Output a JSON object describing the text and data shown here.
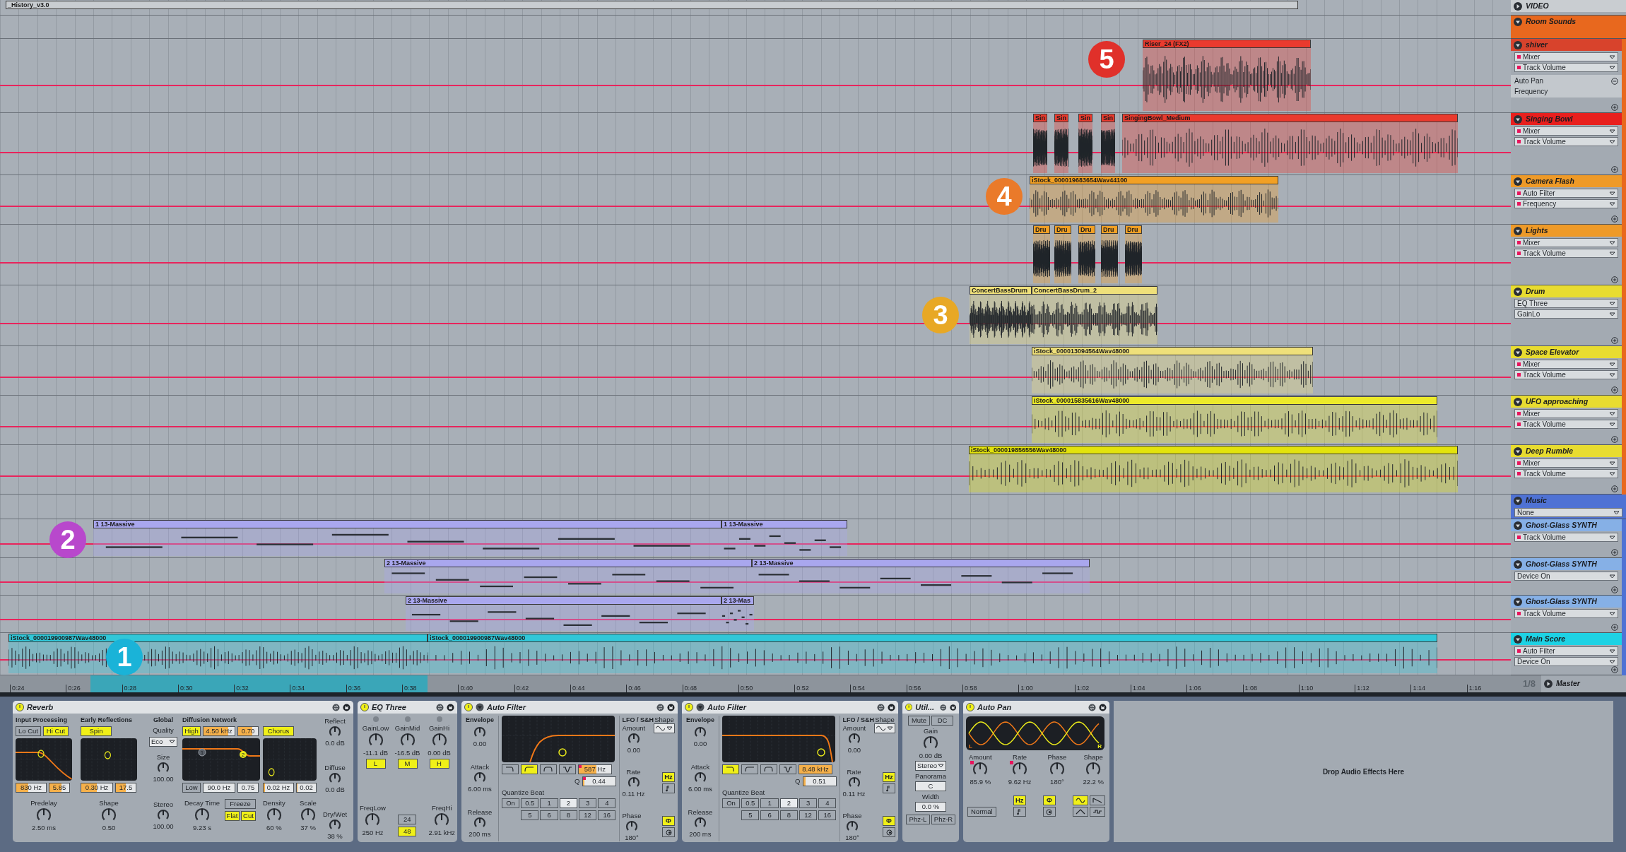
{
  "tracks": [
    {
      "kind": "video",
      "name": "VIDEO",
      "color": "#c9cdd1",
      "expanded": false,
      "clips": [
        {
          "label": "_History_v3.0",
          "color": "#c9cdd1"
        }
      ]
    },
    {
      "kind": "group",
      "name": "Room Sounds",
      "color": "#e8681e",
      "expanded": true,
      "children": [
        {
          "kind": "audio",
          "name": "shiver",
          "color": "#d8432c",
          "expanded": true,
          "choosers": [
            {
              "label": "Mixer",
              "automated": true
            },
            {
              "label": "Track Volume",
              "automated": true
            }
          ],
          "sub": {
            "device": "Auto Pan",
            "parameter": "Frequency"
          },
          "clips": [
            {
              "label": "Riser_24 (FX2)",
              "color": "#ea3a2e"
            }
          ]
        },
        {
          "kind": "audio",
          "name": "Singing Bowl",
          "color": "#e8201e",
          "expanded": true,
          "choosers": [
            {
              "label": "Mixer",
              "automated": true
            },
            {
              "label": "Track Volume",
              "automated": true
            }
          ],
          "clips": [
            {
              "label": "Sin",
              "color": "#ea3a2e"
            },
            {
              "label": "Sin",
              "color": "#ea3a2e"
            },
            {
              "label": "Sin",
              "color": "#ea3a2e"
            },
            {
              "label": "Sin",
              "color": "#ea3a2e"
            },
            {
              "label": "SingingBowl_Medium",
              "color": "#ea3a2e"
            }
          ]
        },
        {
          "kind": "audio",
          "name": "Camera Flash",
          "color": "#ee9a28",
          "expanded": true,
          "choosers": [
            {
              "label": "Auto Filter",
              "automated": true
            },
            {
              "label": "Frequency",
              "automated": true
            }
          ],
          "clips": [
            {
              "label": "iStock_000019683654Wav44100",
              "color": "#f2a024"
            }
          ]
        },
        {
          "kind": "audio",
          "name": "Lights",
          "color": "#ee9a28",
          "expanded": true,
          "choosers": [
            {
              "label": "Mixer",
              "automated": true
            },
            {
              "label": "Track Volume",
              "automated": true
            }
          ],
          "clips": [
            {
              "label": "Dru",
              "color": "#f2a024"
            },
            {
              "label": "Dru",
              "color": "#f2a024"
            },
            {
              "label": "Dru",
              "color": "#f2a024"
            },
            {
              "label": "Dru",
              "color": "#f2a024"
            },
            {
              "label": "Dru",
              "color": "#f2a024"
            }
          ]
        },
        {
          "kind": "audio",
          "name": "Drum",
          "color": "#e8dc30",
          "expanded": true,
          "choosers": [
            {
              "label": "EQ Three",
              "automated": false
            },
            {
              "label": "GainLo",
              "automated": false
            }
          ],
          "clips": [
            {
              "label": "ConcertBassDrum",
              "color": "#efe07a"
            },
            {
              "label": "ConcertBassDrum_2",
              "color": "#efe07a"
            }
          ]
        },
        {
          "kind": "audio",
          "name": "Space Elevator",
          "color": "#e8dc30",
          "expanded": true,
          "choosers": [
            {
              "label": "Mixer",
              "automated": true
            },
            {
              "label": "Track Volume",
              "automated": true
            }
          ],
          "clips": [
            {
              "label": "iStock_000013094564Wav48000",
              "color": "#efe07a"
            }
          ]
        },
        {
          "kind": "audio",
          "name": "UFO approaching",
          "color": "#e8dc30",
          "expanded": true,
          "choosers": [
            {
              "label": "Mixer",
              "automated": true
            },
            {
              "label": "Track Volume",
              "automated": true
            }
          ],
          "clips": [
            {
              "label": "iStock_000015835616Wav48000",
              "color": "#ecea2a"
            }
          ]
        },
        {
          "kind": "audio",
          "name": "Deep Rumble",
          "color": "#e8dc30",
          "expanded": true,
          "choosers": [
            {
              "label": "Mixer",
              "automated": true
            },
            {
              "label": "Track Volume",
              "automated": true
            }
          ],
          "clips": [
            {
              "label": "iStock_000019856556Wav48000",
              "color": "#e3e30c"
            }
          ]
        }
      ]
    },
    {
      "kind": "group",
      "name": "Music",
      "color": "#4f72d4",
      "expanded": true,
      "choosers": [
        {
          "label": "None",
          "automated": false
        }
      ],
      "children": [
        {
          "kind": "midi",
          "name": "Ghost-Glass SYNTH",
          "color": "#86b0e6",
          "expanded": true,
          "choosers": [
            {
              "label": "Track Volume",
              "automated": true
            }
          ],
          "clips": [
            {
              "label": "1 13-Massive",
              "color": "#a9a7ee"
            },
            {
              "label": "1 13-Massive",
              "color": "#a9a7ee"
            }
          ]
        },
        {
          "kind": "midi",
          "name": "Ghost-Glass SYNTH",
          "color": "#86b0e6",
          "expanded": true,
          "choosers": [
            {
              "label": "Device On",
              "automated": false
            }
          ],
          "clips": [
            {
              "label": "2 13-Massive",
              "color": "#a9a7ee"
            },
            {
              "label": "2 13-Massive",
              "color": "#a9a7ee"
            }
          ]
        },
        {
          "kind": "midi",
          "name": "Ghost-Glass SYNTH",
          "color": "#86b0e6",
          "expanded": true,
          "choosers": [
            {
              "label": "Track Volume",
              "automated": true
            }
          ],
          "clips": [
            {
              "label": "2 13-Massive",
              "color": "#a9a7ee"
            },
            {
              "label": "2 13-Mas",
              "color": "#a9a7ee"
            }
          ]
        },
        {
          "kind": "audio",
          "name": "Main Score",
          "color": "#1ed2e4",
          "expanded": true,
          "choosers": [
            {
              "label": "Auto Filter",
              "automated": true
            },
            {
              "label": "Device On",
              "automated": false
            }
          ],
          "clips": [
            {
              "label": "iStock_000019900987Wav48000",
              "color": "#31c7d8"
            },
            {
              "label": "iStock_000019900987Wav48000",
              "color": "#31c7d8"
            }
          ]
        }
      ]
    }
  ],
  "markers": [
    {
      "label": "5",
      "color": "#e0302a"
    },
    {
      "label": "4",
      "color": "#ea7a2a"
    },
    {
      "label": "3",
      "color": "#e8a825"
    },
    {
      "label": "2",
      "color": "#b848cc"
    },
    {
      "label": "1",
      "color": "#1ab3d8"
    }
  ],
  "ruler": {
    "labels": [
      "0:24",
      "0:26",
      "0:28",
      "0:30",
      "0:32",
      "0:34",
      "0:36",
      "0:38",
      "0:40",
      "0:42",
      "0:44",
      "0:46",
      "0:48",
      "0:50",
      "0:52",
      "0:54",
      "0:56",
      "0:58",
      "1:00",
      "1:02",
      "1:04",
      "1:06",
      "1:08",
      "1:10",
      "1:12",
      "1:14",
      "1:16"
    ],
    "grid": "1/8"
  },
  "master": {
    "name": "Master",
    "expanded": false
  },
  "devices": [
    {
      "kind": "reverb",
      "title": "Reverb",
      "on": true,
      "input": {
        "heading": "Input Processing",
        "buttons": [
          {
            "label": "Lo Cut",
            "on": false
          },
          {
            "label": "Hi Cut",
            "on": true
          }
        ],
        "fields": [
          {
            "value": "830 Hz",
            "level": 0.4
          },
          {
            "value": "5.85",
            "level": 0.6
          }
        ],
        "knob": {
          "label": "Predelay",
          "value": "2.50 ms"
        }
      },
      "early": {
        "heading": "Early Reflections",
        "buttons": [
          {
            "label": "Spin",
            "on": true
          }
        ],
        "fields": [
          {
            "value": "0.30 Hz",
            "level": 0.5
          },
          {
            "value": "17.5",
            "level": 0.5
          }
        ],
        "knob": {
          "label": "Shape",
          "value": "0.50"
        }
      },
      "global": {
        "heading": "Global",
        "quality_label": "Quality",
        "quality": "Eco",
        "knobs": [
          {
            "label": "Size",
            "value": "100.00"
          },
          {
            "label": "Stereo",
            "value": "100.00"
          }
        ]
      },
      "diffusion": {
        "heading": "Diffusion Network",
        "high": {
          "label": "High",
          "on": true
        },
        "high_fields": [
          {
            "value": "4.50 kHz",
            "level": 0.8
          },
          {
            "value": "0.70",
            "level": 0.7
          }
        ],
        "low": {
          "label": "Low",
          "on": false
        },
        "low_fields": [
          {
            "value": "90.0 Hz"
          },
          {
            "value": "0.75"
          }
        ],
        "points": [
          "1",
          "2"
        ],
        "knob": {
          "label": "Decay Time",
          "value": "9.23 s"
        },
        "freeze": {
          "label": "Freeze",
          "on": false
        },
        "freeze_opts": [
          {
            "label": "Flat",
            "on": true
          },
          {
            "label": "Cut",
            "on": true
          }
        ]
      },
      "chorus": {
        "button": {
          "label": "Chorus",
          "on": true
        },
        "fields": [
          {
            "value": "0.02 Hz",
            "level": 0.05
          },
          {
            "value": "0.02",
            "level": 0.05
          }
        ],
        "knobs": [
          {
            "label": "Density",
            "value": "60 %"
          },
          {
            "label": "Scale",
            "value": "37 %"
          }
        ]
      },
      "out": [
        {
          "label": "Reflect",
          "value": "0.0 dB"
        },
        {
          "label": "Diffuse",
          "value": "0.0 dB"
        },
        {
          "label": "Dry/Wet",
          "value": "38 %"
        }
      ]
    },
    {
      "kind": "eq3",
      "title": "EQ Three",
      "on": true,
      "gains": [
        {
          "label": "GainLow",
          "value": "-11.1 dB"
        },
        {
          "label": "GainMid",
          "value": "-16.5 dB"
        },
        {
          "label": "GainHi",
          "value": "0.00 dB"
        }
      ],
      "bands": [
        {
          "label": "L",
          "on": true
        },
        {
          "label": "M",
          "on": true
        },
        {
          "label": "H",
          "on": true
        }
      ],
      "freqs": [
        {
          "label": "FreqLow",
          "value": "250 Hz"
        },
        {
          "label": "FreqHi",
          "value": "2.91 kHz"
        }
      ],
      "slopes": [
        {
          "label": "24",
          "selected": false
        },
        {
          "label": "48",
          "selected": true
        }
      ]
    },
    {
      "kind": "autofilter",
      "title": "Auto Filter",
      "on": true,
      "envelope": {
        "heading": "Envelope",
        "knobs": [
          {
            "value": "0.00"
          },
          {
            "label": "Attack",
            "value": "6.00 ms"
          },
          {
            "label": "Release",
            "value": "200 ms"
          }
        ]
      },
      "filter_types": [
        {
          "kind": "lowpass",
          "selected": false
        },
        {
          "kind": "highpass",
          "selected": true
        },
        {
          "kind": "bandpass",
          "selected": false
        },
        {
          "kind": "notch",
          "selected": false
        }
      ],
      "freq": {
        "value": "587 Hz",
        "level": 0.55,
        "automated": true
      },
      "q": {
        "label": "Q",
        "value": "0.44",
        "level": 0.05,
        "automated": true
      },
      "quantize": {
        "label": "Quantize Beat",
        "buttons": [
          {
            "label": "On",
            "selected": false
          },
          {
            "label": "0.5",
            "selected": false
          },
          {
            "label": "1",
            "selected": false
          },
          {
            "label": "2",
            "selected": true
          },
          {
            "label": "3",
            "selected": false
          },
          {
            "label": "4",
            "selected": false
          },
          {
            "label": "5",
            "selected": false
          },
          {
            "label": "6",
            "selected": false
          },
          {
            "label": "8",
            "selected": false
          },
          {
            "label": "12",
            "selected": false
          },
          {
            "label": "16",
            "selected": false
          }
        ]
      },
      "lfo": {
        "heading": "LFO / S&H",
        "knobs": [
          {
            "label": "Amount",
            "value": "0.00"
          },
          {
            "label": "Rate",
            "value": "0.11 Hz"
          },
          {
            "label": "Phase",
            "value": "180°"
          }
        ],
        "shape_label": "Shape",
        "rate_modes": [
          {
            "kind": "text",
            "label": "Hz",
            "selected": true
          },
          {
            "kind": "note",
            "selected": false
          }
        ],
        "phase_modes": [
          {
            "kind": "text",
            "label": "Φ",
            "selected": true
          },
          {
            "kind": "offset",
            "selected": false
          }
        ]
      }
    },
    {
      "kind": "autofilter",
      "title": "Auto Filter",
      "on": true,
      "envelope": {
        "heading": "Envelope",
        "knobs": [
          {
            "value": "0.00"
          },
          {
            "label": "Attack",
            "value": "6.00 ms"
          },
          {
            "label": "Release",
            "value": "200 ms"
          }
        ]
      },
      "filter_types": [
        {
          "kind": "lowpass",
          "selected": true
        },
        {
          "kind": "highpass",
          "selected": false
        },
        {
          "kind": "bandpass",
          "selected": false
        },
        {
          "kind": "notch",
          "selected": false
        }
      ],
      "freq": {
        "value": "8.48 kHz",
        "level": 1,
        "automated": false
      },
      "q": {
        "label": "Q",
        "value": "0.51",
        "level": 0.08,
        "automated": false
      },
      "quantize": {
        "label": "Quantize Beat",
        "buttons": [
          {
            "label": "On",
            "selected": false
          },
          {
            "label": "0.5",
            "selected": false
          },
          {
            "label": "1",
            "selected": false
          },
          {
            "label": "2",
            "selected": true
          },
          {
            "label": "3",
            "selected": false
          },
          {
            "label": "4",
            "selected": false
          },
          {
            "label": "5",
            "selected": false
          },
          {
            "label": "6",
            "selected": false
          },
          {
            "label": "8",
            "selected": false
          },
          {
            "label": "12",
            "selected": false
          },
          {
            "label": "16",
            "selected": false
          }
        ]
      },
      "lfo": {
        "heading": "LFO / S&H",
        "knobs": [
          {
            "label": "Amount",
            "value": "0.00"
          },
          {
            "label": "Rate",
            "value": "0.11 Hz"
          },
          {
            "label": "Phase",
            "value": "180°"
          }
        ],
        "shape_label": "Shape",
        "rate_modes": [
          {
            "kind": "text",
            "label": "Hz",
            "selected": true
          },
          {
            "kind": "note",
            "selected": false
          }
        ],
        "phase_modes": [
          {
            "kind": "text",
            "label": "Φ",
            "selected": true
          },
          {
            "kind": "offset",
            "selected": false
          }
        ]
      }
    },
    {
      "kind": "utility",
      "title": "Util...",
      "on": true,
      "toggles": [
        {
          "label": "Mute",
          "on": false
        },
        {
          "label": "DC",
          "on": false
        }
      ],
      "gain": {
        "label": "Gain",
        "value": "0.00 dB"
      },
      "mode": "Stereo",
      "panorama": {
        "label": "Panorama",
        "value": "C"
      },
      "width": {
        "label": "Width",
        "value": "0.0 %"
      },
      "phase": [
        {
          "label": "Phz-L",
          "on": false
        },
        {
          "label": "Phz-R",
          "on": false
        }
      ]
    },
    {
      "kind": "autopan",
      "title": "Auto Pan",
      "on": true,
      "display": {
        "left": "L",
        "right": "R"
      },
      "knobs": [
        {
          "label": "Amount",
          "value": "85.9 %",
          "automated": true
        },
        {
          "label": "Rate",
          "value": "9.62 Hz",
          "automated": true
        },
        {
          "label": "Phase",
          "value": "180°",
          "automated": false
        },
        {
          "label": "Shape",
          "value": "22.2 %",
          "automated": false
        }
      ],
      "mode": "Normal",
      "rate_modes": [
        {
          "kind": "text",
          "label": "Hz",
          "selected": true
        },
        {
          "kind": "note",
          "selected": false
        }
      ],
      "phase_modes": [
        {
          "kind": "text",
          "label": "Φ",
          "selected": true
        },
        {
          "kind": "offset",
          "selected": false
        }
      ],
      "shapes": [
        {
          "kind": "sine",
          "selected": true
        },
        {
          "kind": "saw",
          "selected": false
        },
        {
          "kind": "triangle",
          "selected": false
        },
        {
          "kind": "random",
          "selected": false
        }
      ]
    }
  ],
  "drop_hint": "Drop Audio Effects Here"
}
